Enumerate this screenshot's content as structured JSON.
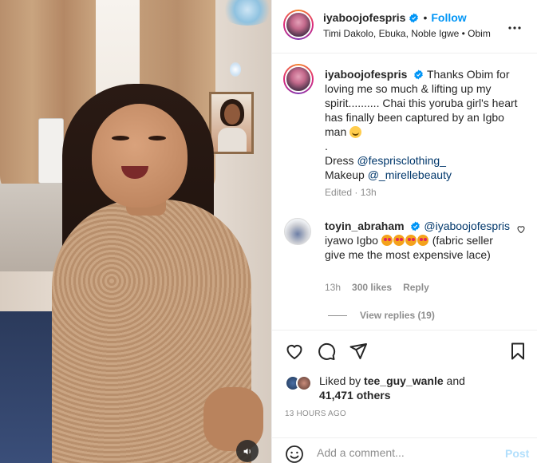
{
  "header": {
    "username": "iyaboojofespris",
    "separator": "•",
    "follow_label": "Follow",
    "tagged": "Timi Dakolo, Ebuka, Noble Igwe • Obim",
    "more_icon": "more-horizontal-icon"
  },
  "caption": {
    "username": "iyaboojofespris",
    "text": "Thanks Obim for loving me so much & lifting up my spirit.......... Chai this yoruba girl's heart has finally been captured by an Igbo man",
    "dot": ".",
    "dress_label": "Dress",
    "dress_tag": "@fesprisclothing_",
    "makeup_label": "Makeup",
    "makeup_tag": "@_mirellebeauty",
    "edited": "Edited · 13h"
  },
  "comment": {
    "username": "toyin_abraham",
    "mention": "@iyaboojofespris",
    "text_start": "iyawo Igbo",
    "text_end": "(fabric seller give me the most expensive lace)",
    "time": "13h",
    "likes": "300 likes",
    "reply_label": "Reply",
    "view_replies": "View replies (19)"
  },
  "actions": {
    "liked_by_prefix": "Liked by",
    "liked_by_user": "tee_guy_wanle",
    "liked_by_and": "and",
    "others": "41,471 others",
    "timestamp": "13 HOURS AGO"
  },
  "composer": {
    "placeholder": "Add a comment...",
    "post_label": "Post"
  },
  "colors": {
    "accent": "#0095f6",
    "link": "#00376b",
    "muted": "#8e8e8e",
    "post_disabled": "#b2dffc"
  }
}
